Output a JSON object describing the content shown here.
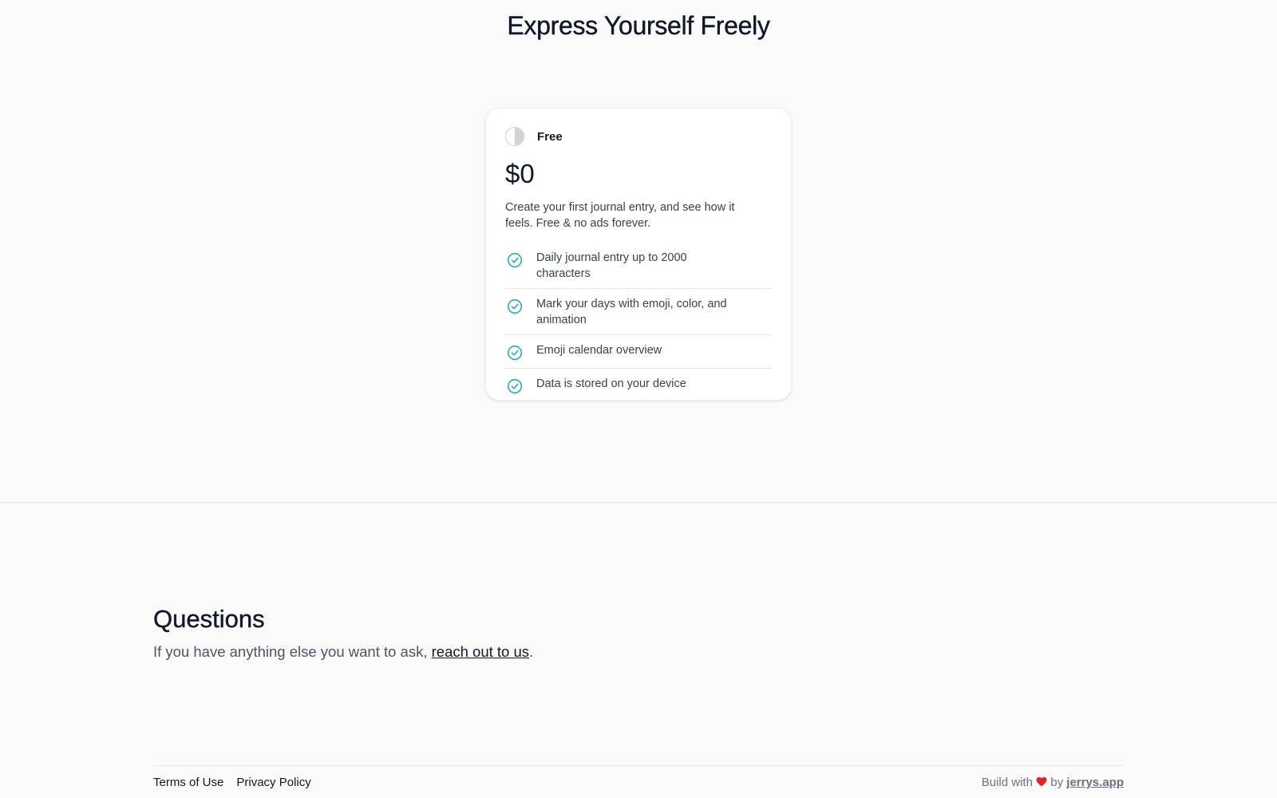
{
  "header": {
    "title": "Express Yourself Freely"
  },
  "plan": {
    "name": "Free",
    "icon": "half-circle-icon",
    "price": "$0",
    "description": "Create your first journal entry, and see how it feels. Free & no ads forever.",
    "check_color": "#14a8b8",
    "features": [
      {
        "label": "Daily journal entry up to 2000 characters",
        "icon": "check-circle-icon"
      },
      {
        "label": "Mark your days with emoji, color, and animation",
        "icon": "check-circle-icon"
      },
      {
        "label": "Emoji calendar overview",
        "icon": "check-circle-icon"
      },
      {
        "label": "Data is stored on your device",
        "icon": "check-circle-icon"
      }
    ]
  },
  "questions": {
    "title": "Questions",
    "text_before": "If you have anything else you want to ask, ",
    "link_label": "reach out to us",
    "text_after": "."
  },
  "footer": {
    "links": [
      {
        "label": "Terms of Use"
      },
      {
        "label": "Privacy Policy"
      }
    ],
    "credit_before": "Build with",
    "heart_icon": "heart-icon",
    "credit_by": "by",
    "credit_link": "jerrys.app"
  }
}
